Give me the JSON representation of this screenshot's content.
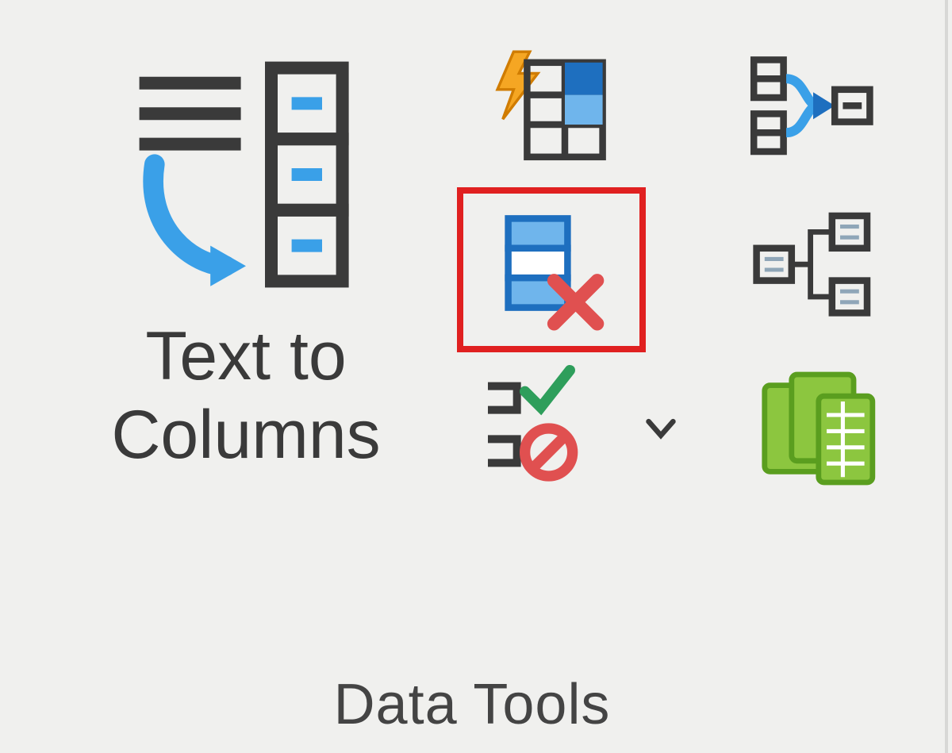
{
  "ribbon_group": {
    "title": "Data Tools",
    "text_to_columns": {
      "label_line1": "Text to",
      "label_line2": "Columns"
    },
    "buttons": {
      "flash_fill": "Flash Fill",
      "remove_duplicates": "Remove Duplicates",
      "data_validation": "Data Validation",
      "consolidate": "Consolidate",
      "relationships": "Relationships",
      "data_model": "Manage Data Model"
    },
    "highlighted": "remove_duplicates"
  }
}
